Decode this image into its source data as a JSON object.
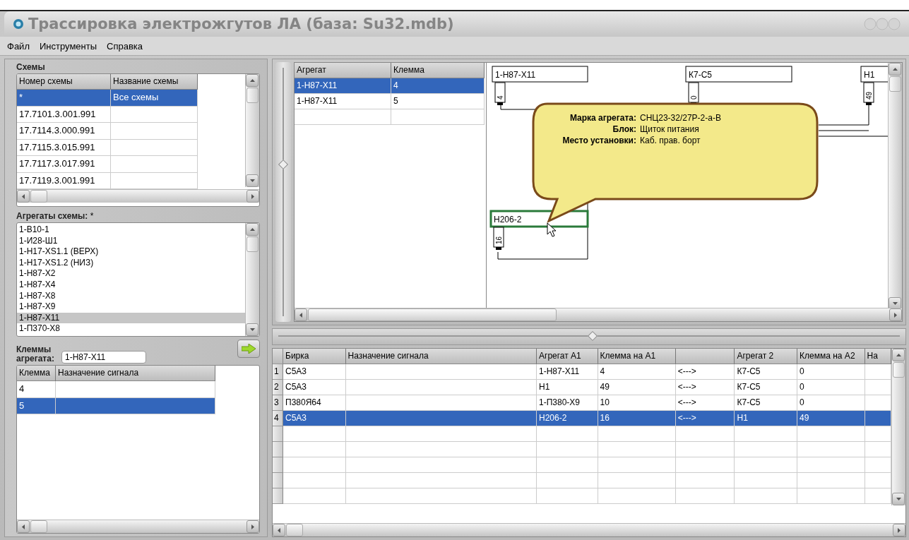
{
  "window": {
    "title": "Трассировка электрожгутов ЛА (база: Su32.mdb)"
  },
  "menu": [
    "Файл",
    "Инструменты",
    "Справка"
  ],
  "schemes": {
    "title": "Схемы",
    "columns": [
      "Номер схемы",
      "Название схемы"
    ],
    "rows": [
      {
        "cells": [
          "*",
          "Все схемы"
        ],
        "selected": true
      },
      {
        "cells": [
          "17.7101.3.001.991",
          null
        ],
        "selected": false
      },
      {
        "cells": [
          "17.7114.3.000.991",
          null
        ],
        "selected": false
      },
      {
        "cells": [
          "17.7115.3.015.991",
          null
        ],
        "selected": false
      },
      {
        "cells": [
          "17.7117.3.017.991",
          null
        ],
        "selected": false
      },
      {
        "cells": [
          "17.7119.3.001.991",
          null
        ],
        "selected": false
      }
    ]
  },
  "aggregates": {
    "label": "Агрегаты схемы:",
    "filter": "*",
    "items": [
      {
        "label": "1-В10-1",
        "selected": false
      },
      {
        "label": "1-И28-Ш1",
        "selected": false
      },
      {
        "label": "1-Н17-XS1.1 (ВЕРХ)",
        "selected": false
      },
      {
        "label": "1-Н17-XS1.2 (НИЗ)",
        "selected": false
      },
      {
        "label": "1-Н87-Х2",
        "selected": false
      },
      {
        "label": "1-Н87-Х4",
        "selected": false
      },
      {
        "label": "1-Н87-Х8",
        "selected": false
      },
      {
        "label": "1-Н87-Х9",
        "selected": false
      },
      {
        "label": "1-Н87-Х11",
        "selected": true
      },
      {
        "label": "1-П370-Х8",
        "selected": false
      }
    ]
  },
  "terminals": {
    "label": "Клеммы агрегата:",
    "value": "1-Н87-Х11",
    "columns": [
      "Клемма",
      "Назначение сигнала"
    ],
    "rows": [
      {
        "cells": [
          "4",
          null
        ],
        "selected": false
      },
      {
        "cells": [
          "5",
          null
        ],
        "selected": true
      }
    ]
  },
  "pins_table": {
    "columns": [
      "Агрегат",
      "Клемма"
    ],
    "rows": [
      {
        "cells": [
          "1-Н87-Х11",
          "4"
        ],
        "selected": true
      },
      {
        "cells": [
          "1-Н87-Х11",
          "5"
        ],
        "selected": false
      }
    ]
  },
  "diagram": {
    "nodes": [
      {
        "label": "1-Н87-Х11",
        "pin": "4",
        "selected": false
      },
      {
        "label": "К7-С5",
        "pin": "0",
        "selected": false
      },
      {
        "label": "Н1",
        "pin": "49",
        "selected": false
      },
      {
        "label": "Н206-2",
        "pin": "16",
        "selected": true
      }
    ],
    "tooltip": [
      {
        "label": "Марка агрегата:",
        "value": "СНЦ23-32/27Р-2-а-В"
      },
      {
        "label": "Блок:",
        "value": "Щиток питания"
      },
      {
        "label": "Место установки:",
        "value": "Каб. прав. борт"
      }
    ]
  },
  "connections": {
    "columns": [
      {
        "kind": "text",
        "label": "Бирка"
      },
      {
        "kind": "text",
        "label": "Назначение  сигнала"
      },
      {
        "kind": "text",
        "label": "Агрегат А1"
      },
      {
        "kind": "text",
        "label": "Клемма на А1"
      },
      {
        "kind": "blank"
      },
      {
        "kind": "text",
        "label": "Агрегат 2"
      },
      {
        "kind": "text",
        "label": "Клемма на А2"
      },
      {
        "kind": "text",
        "label": "На"
      }
    ],
    "rows": [
      {
        "number": "1",
        "cells": [
          "С5А3",
          null,
          "1-Н87-Х11",
          "4",
          "<--->",
          "К7-С5",
          "0",
          null
        ],
        "selected": false
      },
      {
        "number": "2",
        "cells": [
          "С5А3",
          null,
          "Н1",
          "49",
          "<--->",
          "К7-С5",
          "0",
          null
        ],
        "selected": false
      },
      {
        "number": "3",
        "cells": [
          "П380Я64",
          null,
          "1-П380-Х9",
          "10",
          "<--->",
          "К7-С5",
          "0",
          null
        ],
        "selected": false
      },
      {
        "number": "4",
        "cells": [
          "С5А3",
          null,
          "Н206-2",
          "16",
          "<--->",
          "Н1",
          "49",
          null
        ],
        "selected": true
      }
    ]
  }
}
